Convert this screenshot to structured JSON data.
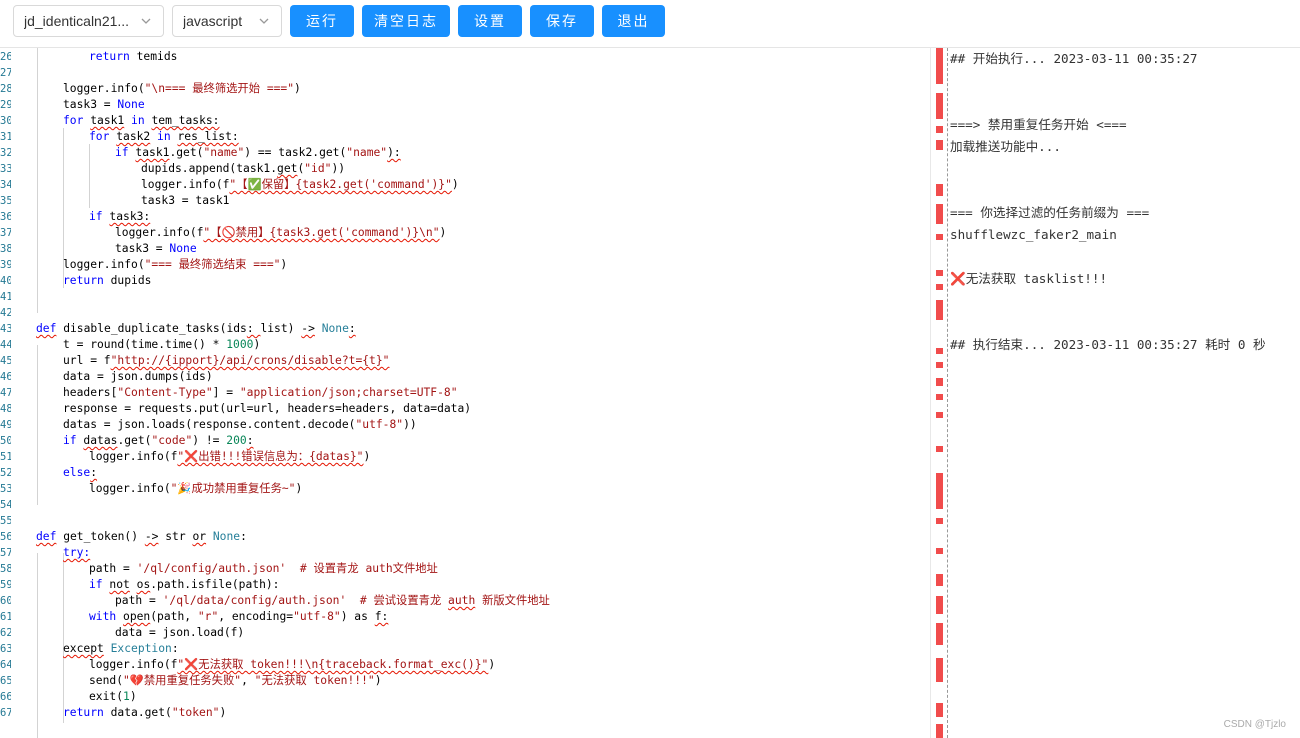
{
  "toolbar": {
    "script_select": "jd_identicaln21...",
    "language_select": "javascript",
    "run_label": "运行",
    "clear_log_label": "清空日志",
    "settings_label": "设置",
    "save_label": "保存",
    "exit_label": "退出",
    "chevron_icon": "chevron-down-icon"
  },
  "editor": {
    "line_numbers": [
      "26",
      "27",
      "28",
      "29",
      "30",
      "31",
      "32",
      "33",
      "34",
      "35",
      "36",
      "37",
      "38",
      "39",
      "40",
      "41",
      "42",
      "43",
      "44",
      "45",
      "46",
      "47",
      "48",
      "49",
      "50",
      "51",
      "52",
      "53",
      "54",
      "55",
      "56",
      "57",
      "58",
      "59",
      "60",
      "61",
      "62",
      "63",
      "64",
      "65",
      "66",
      "67"
    ]
  },
  "log": {
    "lines": [
      "## 开始执行... 2023-03-11 00:35:27",
      "===> 禁用重复任务开始 <===",
      "加载推送功能中...",
      "=== 你选择过滤的任务前缀为 ===",
      "shufflewzc_faker2_main",
      "无法获取 tasklist!!!",
      "## 执行结束... 2023-03-11 00:35:27 耗时 0 秒"
    ],
    "error_icon": "x-mark-icon"
  },
  "watermark": "CSDN @Tjzlo",
  "colors": {
    "accent": "#1890ff",
    "ruler_mark": "#f14c4c",
    "keyword": "#0000ff",
    "string": "#a31515"
  }
}
